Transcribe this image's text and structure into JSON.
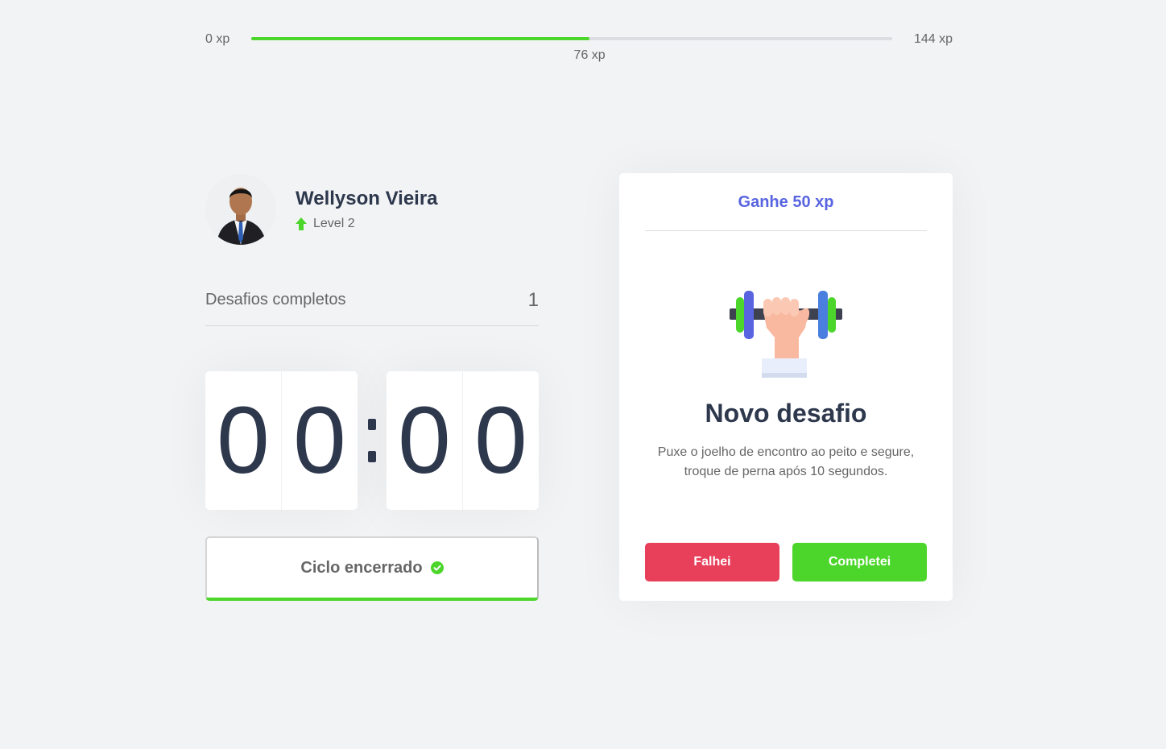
{
  "experience": {
    "min_label": "0 xp",
    "max_label": "144 xp",
    "current_label": "76 xp",
    "current_xp": 76,
    "max_xp": 144,
    "fill_color": "#4cd62b"
  },
  "profile": {
    "name": "Wellyson Vieira",
    "level_label": "Level 2",
    "level_icon": "level-up-arrow-icon"
  },
  "completed_challenges": {
    "label": "Desafios completos",
    "count": "1"
  },
  "countdown": {
    "minute_left": "0",
    "minute_right": "0",
    "second_left": "0",
    "second_right": "0"
  },
  "cycle": {
    "label": "Ciclo encerrado",
    "status_icon": "check-circle-icon"
  },
  "challenge": {
    "header": "Ganhe 50 xp",
    "icon": "dumbbell-icon",
    "title": "Novo desafio",
    "description": "Puxe o joelho de encontro ao peito e segure, troque de perna após 10 segundos.",
    "failed_label": "Falhei",
    "succeeded_label": "Completei"
  },
  "colors": {
    "background": "#f2f3f5",
    "title": "#2e384d",
    "text": "#666666",
    "blue": "#5965e0",
    "green": "#4cd62b",
    "red": "#e83f5b"
  }
}
